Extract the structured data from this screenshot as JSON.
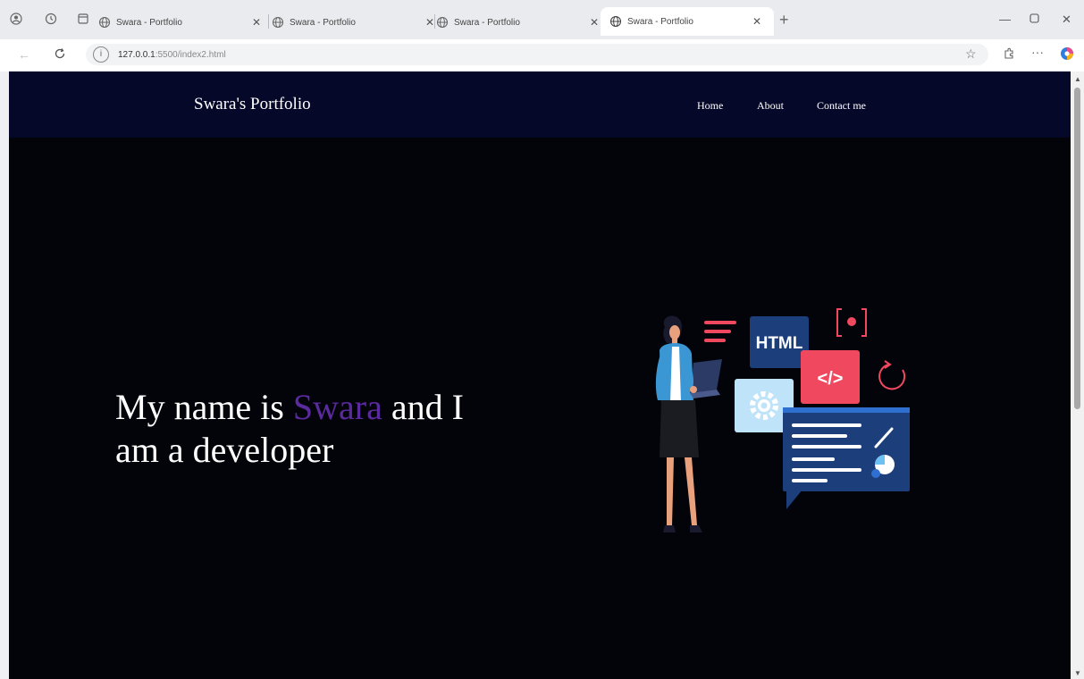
{
  "browser": {
    "tabs": [
      {
        "title": "Swara - Portfolio",
        "active": false
      },
      {
        "title": "Swara - Portfolio",
        "active": false
      },
      {
        "title": "Swara - Portfolio",
        "active": false
      },
      {
        "title": "Swara - Portfolio",
        "active": true
      }
    ],
    "new_tab_label": "+",
    "url_host": "127.0.0.1",
    "url_rest": ":5500/index2.html",
    "icons": {
      "profile": "profile-icon",
      "history": "history-icon",
      "tab_actions": "tab-actions-icon",
      "back": "back-arrow-icon",
      "reload": "reload-icon",
      "site_info": "info-icon",
      "favorite": "star-icon",
      "extensions": "extensions-icon",
      "more": "more-icon",
      "copilot": "copilot-icon"
    }
  },
  "site": {
    "brand": "Swara's Portfolio",
    "nav": [
      "Home",
      "About",
      "Contact me"
    ],
    "hero": {
      "prefix": "My name is ",
      "highlight": "Swara",
      "suffix": " and I am a developer"
    },
    "illustration": {
      "badge_html": "HTML",
      "badge_code": "</>"
    },
    "colors": {
      "navbar_bg": "#06082a",
      "page_bg": "#03030a",
      "highlight": "#5a2a9e"
    }
  }
}
